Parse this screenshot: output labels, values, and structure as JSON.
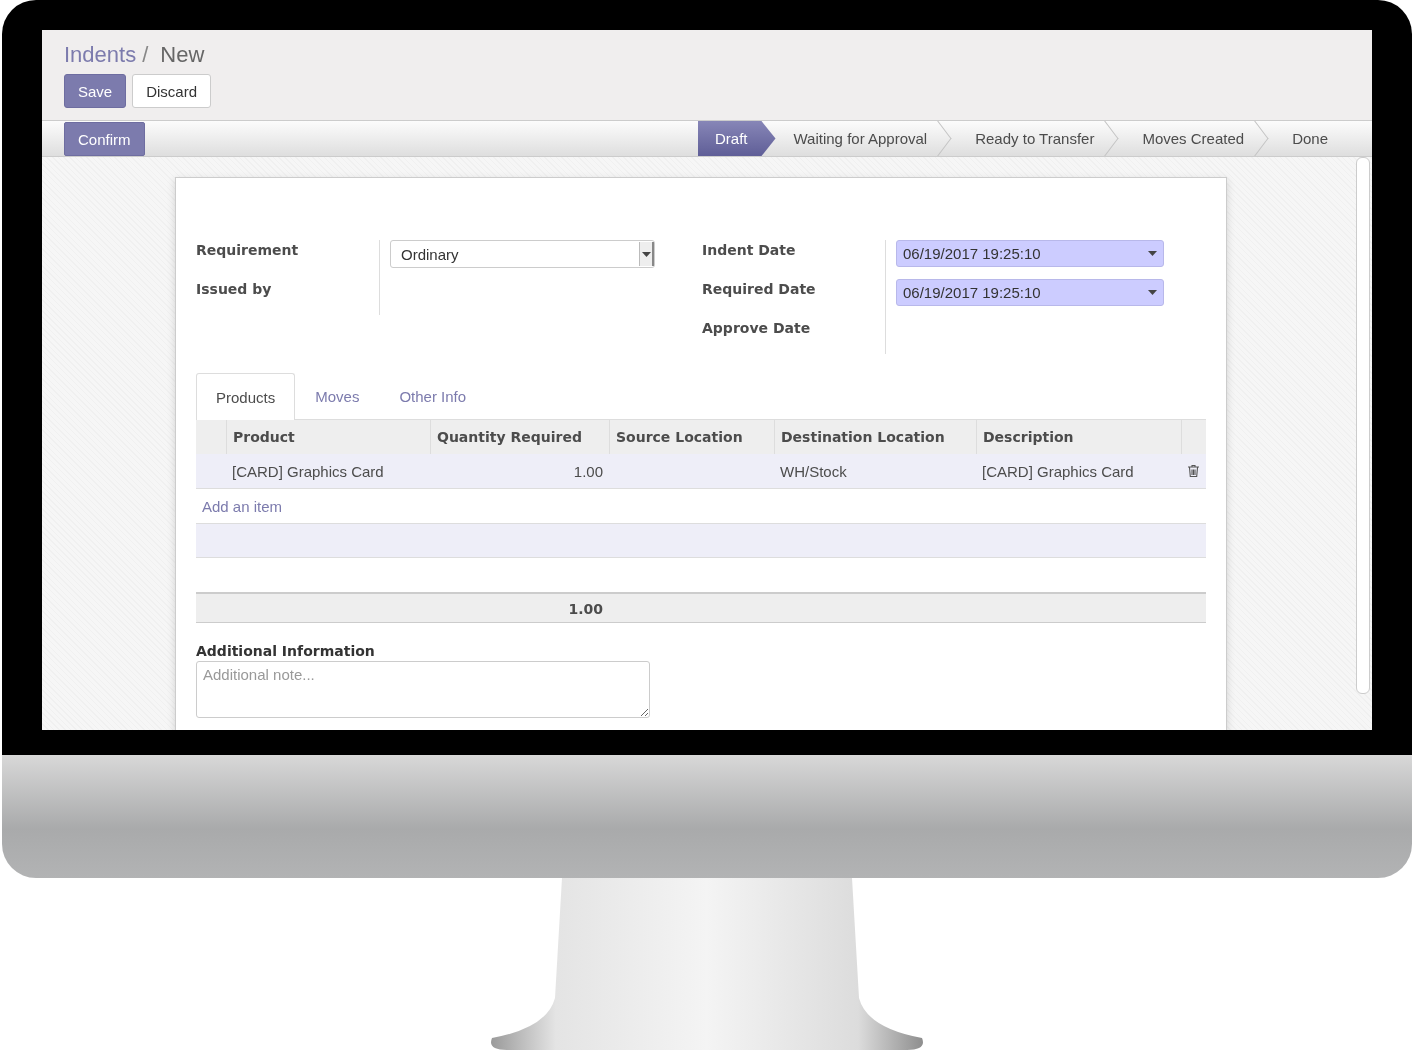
{
  "breadcrumb": {
    "items": [
      {
        "label": "Indents",
        "kind": "link"
      },
      {
        "label": "New",
        "kind": "current"
      }
    ],
    "separator": "/"
  },
  "buttons": [
    {
      "label": "Save",
      "kind": "primary"
    },
    {
      "label": "Discard",
      "kind": "secondary"
    }
  ],
  "status_bar": {
    "actions": [
      {
        "label": "Confirm"
      }
    ],
    "stages": [
      {
        "label": "Draft",
        "selected": true
      },
      {
        "label": "Waiting for Approval",
        "selected": false
      },
      {
        "label": "Ready to Transfer",
        "selected": false
      },
      {
        "label": "Moves Created",
        "selected": false
      },
      {
        "label": "Done",
        "selected": false
      }
    ]
  },
  "form": {
    "left_fields": [
      {
        "label": "Requirement",
        "kind": "select",
        "value": "Ordinary"
      },
      {
        "label": "Issued by",
        "kind": "empty"
      }
    ],
    "right_fields": [
      {
        "label": "Indent Date",
        "kind": "date",
        "value": "06/19/2017 19:25:10"
      },
      {
        "label": "Required Date",
        "kind": "date",
        "value": "06/19/2017 19:25:10"
      },
      {
        "label": "Approve Date",
        "kind": "empty"
      }
    ]
  },
  "tabs": [
    {
      "label": "Products",
      "selected": true
    },
    {
      "label": "Moves",
      "selected": false
    },
    {
      "label": "Other Info",
      "selected": false
    }
  ],
  "table": {
    "columns": [
      "Product",
      "Quantity Required",
      "Source Location",
      "Destination Location",
      "Description"
    ],
    "rows": [
      {
        "cells": [
          "[CARD] Graphics Card",
          "1.00",
          "",
          "WH/Stock",
          "[CARD] Graphics Card"
        ]
      }
    ],
    "add_item": "Add an item",
    "total": "1.00"
  },
  "additional_info": {
    "label": "Additional Information",
    "placeholder": "Additional note..."
  }
}
